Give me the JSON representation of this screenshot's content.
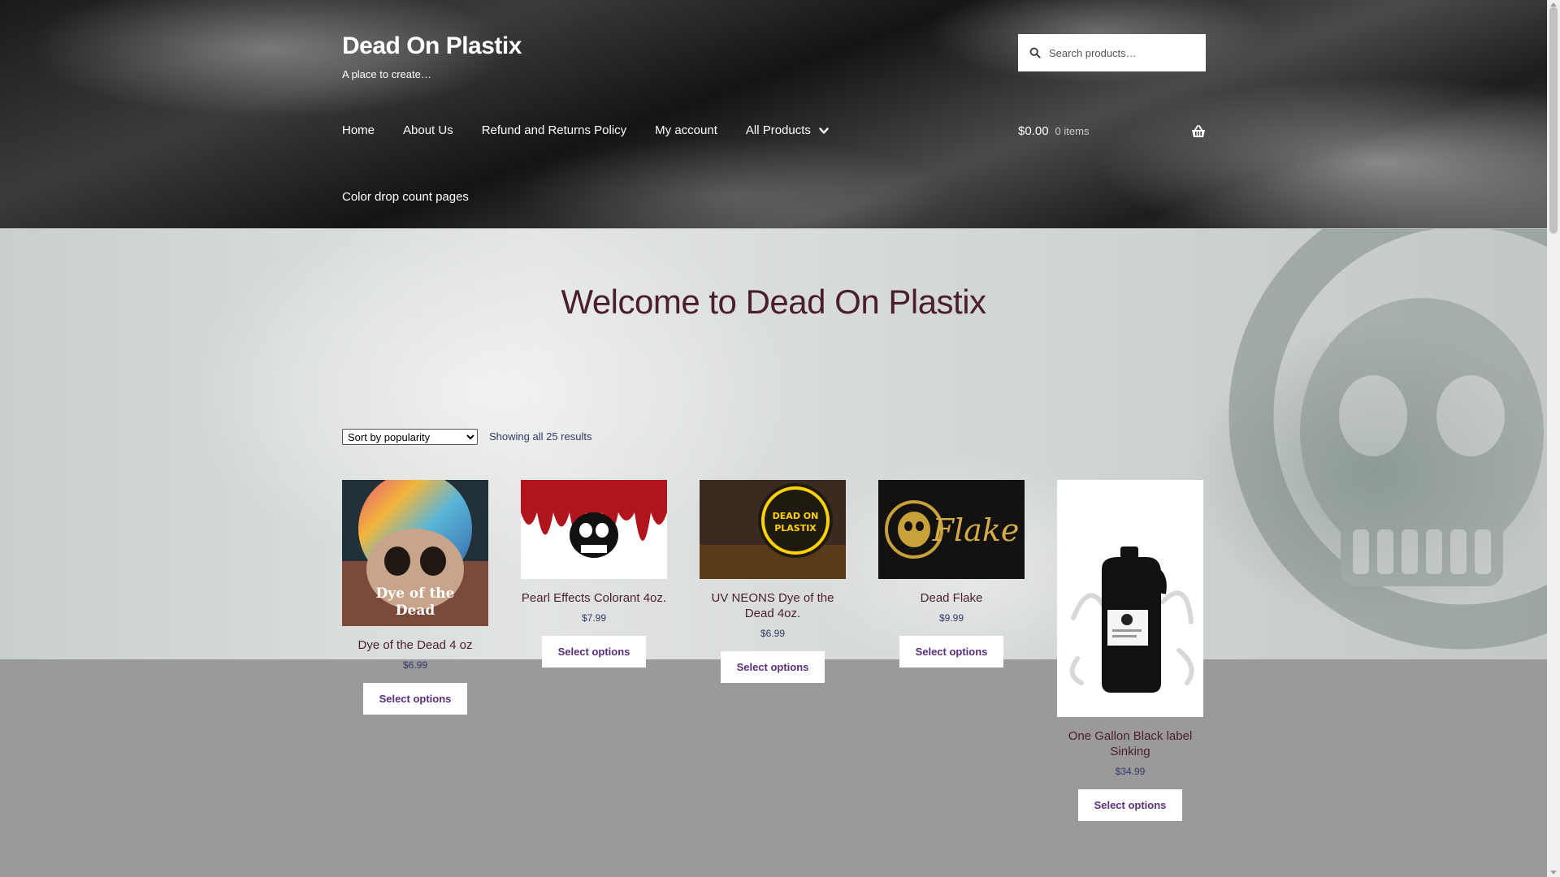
{
  "header": {
    "site_title": "Dead On Plastix",
    "tagline": "A place to create…",
    "search_placeholder": "Search products…",
    "nav": [
      "Home",
      "About Us",
      "Refund and Returns Policy",
      "My account",
      "All Products"
    ],
    "nav_row2": "Color drop count pages",
    "cart_total": "$0.00",
    "cart_items": "0 items"
  },
  "main": {
    "title": "Welcome to Dead On Plastix",
    "sort_selected": "Sort by popularity",
    "result_count": "Showing all 25 results",
    "products": [
      {
        "name": "Dye of the Dead 4 oz",
        "price": "$6.99",
        "button": "Select options",
        "image_text_1": "Dye of the",
        "image_text_2": "Dead"
      },
      {
        "name": "Pearl Effects Colorant 4oz.",
        "price": "$7.99",
        "button": "Select options"
      },
      {
        "name": "UV NEONS Dye of the Dead 4oz.",
        "price": "$6.99",
        "button": "Select options",
        "image_text_1": "DEAD ON",
        "image_text_2": "PLASTIX"
      },
      {
        "name": "Dead Flake",
        "price": "$9.99",
        "button": "Select options",
        "image_text_1": "Flake"
      },
      {
        "name": "One Gallon Black label Sinking",
        "price": "$34.99",
        "button": "Select options"
      }
    ]
  },
  "colors": {
    "title": "#4b1e2c",
    "price": "#2f3a66",
    "button_text": "#5b2e7a"
  }
}
